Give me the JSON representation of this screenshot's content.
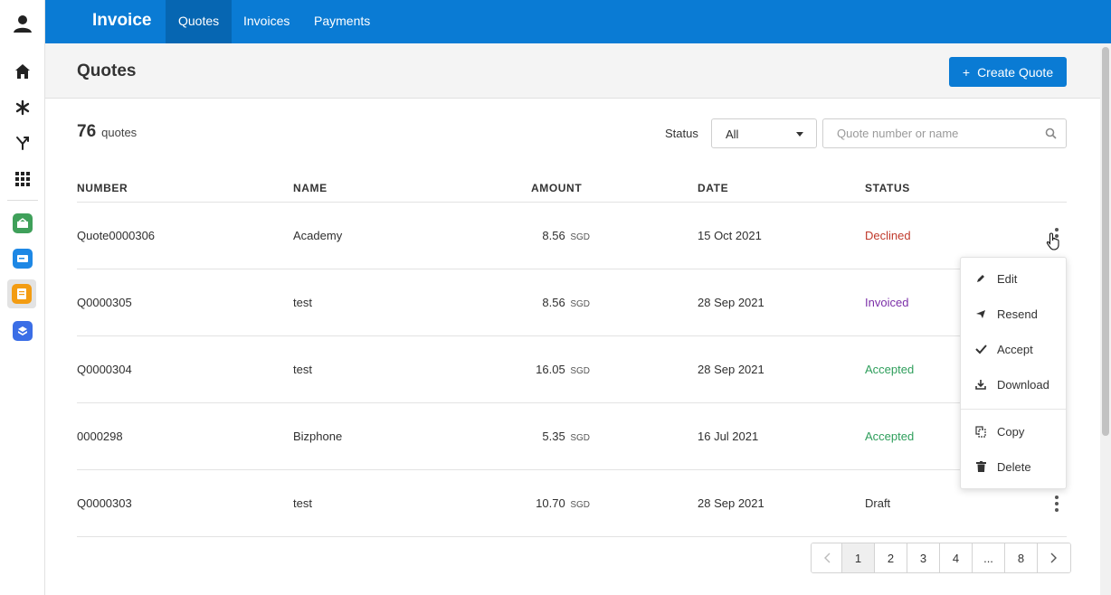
{
  "app": {
    "title": "Invoice"
  },
  "nav": {
    "tabs": [
      {
        "label": "Quotes",
        "active": true
      },
      {
        "label": "Invoices"
      },
      {
        "label": "Payments"
      }
    ]
  },
  "rail": {
    "icons": [
      "user-icon",
      "home-icon",
      "asterisk-icon",
      "branch-icon",
      "grid-icon"
    ],
    "apps": [
      {
        "name": "green-app-icon",
        "color": "#3fa05a"
      },
      {
        "name": "blue-app-icon",
        "color": "#1e88e5"
      },
      {
        "name": "orange-app-icon",
        "color": "#f39c12"
      },
      {
        "name": "purple-app-icon",
        "color": "#3b6ee6"
      }
    ]
  },
  "header": {
    "title": "Quotes",
    "create_button": "Create Quote"
  },
  "summary": {
    "count": "76",
    "count_label": "quotes"
  },
  "filters": {
    "status_label": "Status",
    "status_value": "All",
    "search_placeholder": "Quote number or name"
  },
  "table": {
    "columns": [
      "NUMBER",
      "NAME",
      "AMOUNT",
      "DATE",
      "STATUS"
    ],
    "rows": [
      {
        "number": "Quote0000306",
        "name": "Academy",
        "amount": "8.56",
        "currency": "SGD",
        "date": "15 Oct 2021",
        "status": "Declined",
        "status_color": "#c0392b"
      },
      {
        "number": "Q0000305",
        "name": "test",
        "amount": "8.56",
        "currency": "SGD",
        "date": "28 Sep 2021",
        "status": "Invoiced",
        "status_color": "#7b2fa8"
      },
      {
        "number": "Q0000304",
        "name": "test",
        "amount": "16.05",
        "currency": "SGD",
        "date": "28 Sep 2021",
        "status": "Accepted",
        "status_color": "#2e9e5b"
      },
      {
        "number": "0000298",
        "name": "Bizphone",
        "amount": "5.35",
        "currency": "SGD",
        "date": "16 Jul 2021",
        "status": "Accepted",
        "status_color": "#2e9e5b"
      },
      {
        "number": "Q0000303",
        "name": "test",
        "amount": "10.70",
        "currency": "SGD",
        "date": "28 Sep 2021",
        "status": "Draft",
        "status_color": "#333333"
      }
    ]
  },
  "menu": {
    "items": [
      "Edit",
      "Resend",
      "Accept",
      "Download",
      "Copy",
      "Delete"
    ]
  },
  "pagination": {
    "pages": [
      "1",
      "2",
      "3",
      "4",
      "...",
      "8"
    ],
    "current": "1"
  },
  "colors": {
    "brand": "#0a7bd4",
    "brand_dark": "#0666b2"
  }
}
